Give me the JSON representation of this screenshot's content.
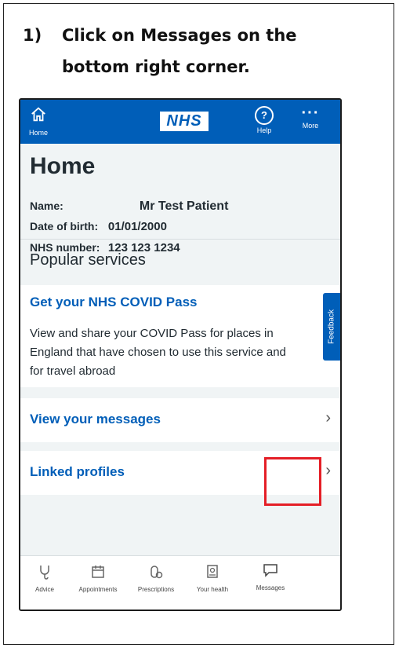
{
  "instruction": {
    "number": "1)",
    "text": "Click on Messages on the bottom right corner."
  },
  "app": {
    "topbar": {
      "home_label": "Home",
      "logo": "NHS",
      "help_label": "Help",
      "more_label": "More",
      "color": "#005eb8"
    },
    "home": {
      "title": "Home",
      "name_label": "Name:",
      "name_value": "Mr Test Patient",
      "dob_label": "Date of birth:",
      "dob_value": "01/01/2000",
      "nhs_label": "NHS number:",
      "nhs_value": "123 123 1234"
    },
    "popular_title": "Popular services",
    "covid_card": {
      "link": "Get your NHS COVID Pass",
      "body": "View and share your COVID Pass for places in England that have chosen to use this service and for travel abroad",
      "feedback": "Feedback"
    },
    "rows": [
      {
        "label": "View your messages"
      },
      {
        "label": "Linked profiles"
      }
    ],
    "chevron": "›",
    "bottom_nav": {
      "advice": "Advice",
      "appointments": "Appointments",
      "prescriptions": "Prescriptions",
      "your_health": "Your health",
      "messages": "Messages"
    },
    "highlight_color": "#e41e26"
  }
}
